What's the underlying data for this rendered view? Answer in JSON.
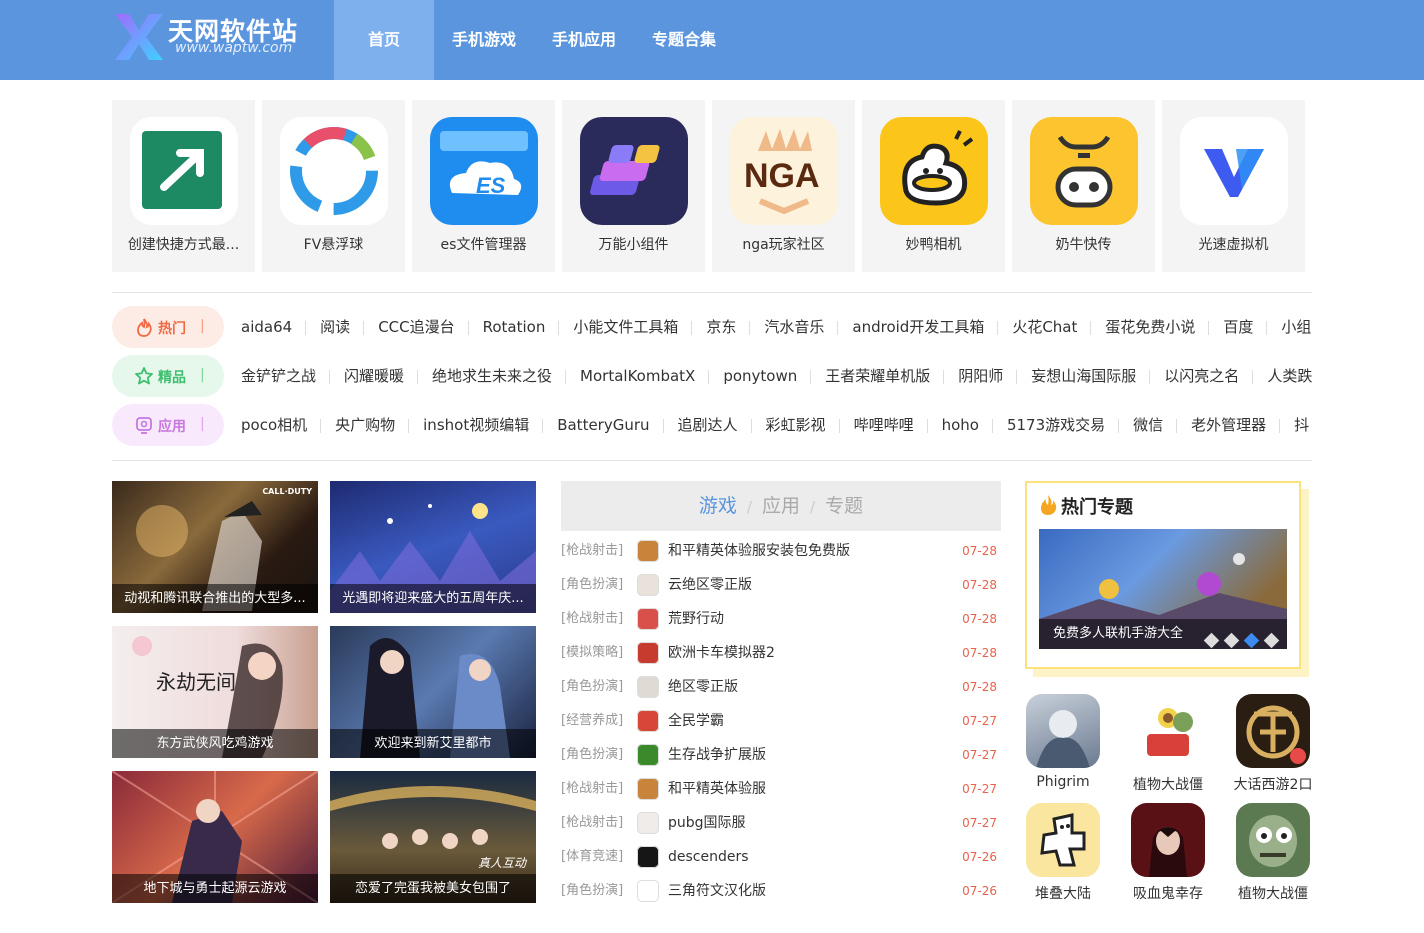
{
  "header": {
    "logo_name": "天网软件站",
    "logo_url": "www.waptw.com",
    "nav": [
      {
        "label": "首页",
        "active": true
      },
      {
        "label": "手机游戏"
      },
      {
        "label": "手机应用"
      },
      {
        "label": "专题合集"
      }
    ],
    "colors": {
      "bar": "#5b95de",
      "active": "#7eb0ee"
    }
  },
  "featured_apps": [
    {
      "name": "创建快捷方式最...",
      "icon": "arrow-shortcut-icon",
      "bg": "#1e8a63"
    },
    {
      "name": "FV悬浮球",
      "icon": "ring-icon",
      "bg": "#ffffff"
    },
    {
      "name": "es文件管理器",
      "icon": "es-folder-cloud-icon",
      "bg": "#1f8df0"
    },
    {
      "name": "万能小组件",
      "icon": "widget-stack-icon",
      "bg": "#2a2b5a"
    },
    {
      "name": "nga玩家社区",
      "icon": "nga-logo-icon",
      "bg": "#fdf2dc"
    },
    {
      "name": "妙鸭相机",
      "icon": "duck-camera-icon",
      "bg": "#fcc51a"
    },
    {
      "name": "奶牛快传",
      "icon": "cow-face-icon",
      "bg": "#fcc52f"
    },
    {
      "name": "光速虚拟机",
      "icon": "v-logo-icon",
      "bg": "#ffffff"
    }
  ],
  "tag_rows": [
    {
      "label": "热门",
      "sep": "|",
      "icon": "fire-icon",
      "color": "#f06a44",
      "bg": "#fdece6",
      "items": [
        "aida64",
        "阅读",
        "CCC追漫台",
        "Rotation",
        "小能文件工具箱",
        "京东",
        "汽水音乐",
        "android开发工具箱",
        "火花Chat",
        "蛋花免费小说",
        "百度",
        "小组"
      ]
    },
    {
      "label": "精品",
      "sep": "|",
      "icon": "star-icon",
      "color": "#3cbf6e",
      "bg": "#e6f7ec",
      "items": [
        "金铲铲之战",
        "闪耀暖暖",
        "绝地求生未来之役",
        "MortalKombatX",
        "ponytown",
        "王者荣耀单机版",
        "阴阳师",
        "妄想山海国际服",
        "以闪亮之名",
        "人类跌"
      ]
    },
    {
      "label": "应用",
      "sep": "|",
      "icon": "app-icon",
      "color": "#c877e0",
      "bg": "#f8eafc",
      "items": [
        "poco相机",
        "央广购物",
        "inshot视频编辑",
        "BatteryGuru",
        "追剧达人",
        "彩虹影视",
        "哔哩哔哩",
        "hoho",
        "5173游戏交易",
        "微信",
        "老外管理器",
        "抖"
      ]
    }
  ],
  "news": [
    {
      "caption": "动视和腾讯联合推出的大型多...",
      "badge": "CALL·DUTY"
    },
    {
      "caption": "光遇即将迎来盛大的五周年庆..."
    },
    {
      "caption": "东方武侠风吃鸡游戏",
      "badge": "永劫无间"
    },
    {
      "caption": "欢迎来到新艾里都市"
    },
    {
      "caption": "地下城与勇士起源云游戏"
    },
    {
      "caption": "恋爱了完蛋我被美女包围了",
      "badge": "真人互动"
    }
  ],
  "list": {
    "tabs": [
      {
        "label": "游戏",
        "active": true
      },
      {
        "label": "应用"
      },
      {
        "label": "专题"
      }
    ],
    "sep": "/",
    "rows": [
      {
        "cat": "[枪战射击]",
        "name": "和平精英体验服安装包免费版",
        "date": "07-28",
        "color": "#c8843a"
      },
      {
        "cat": "[角色扮演]",
        "name": "云绝区零正版",
        "date": "07-28",
        "color": "#e8e2da"
      },
      {
        "cat": "[枪战射击]",
        "name": "荒野行动",
        "date": "07-28",
        "color": "#d9504a"
      },
      {
        "cat": "[模拟策略]",
        "name": "欧洲卡车模拟器2",
        "date": "07-28",
        "color": "#c73a2e"
      },
      {
        "cat": "[角色扮演]",
        "name": "绝区零正版",
        "date": "07-28",
        "color": "#e0dad4"
      },
      {
        "cat": "[经营养成]",
        "name": "全民学霸",
        "date": "07-27",
        "color": "#d84637"
      },
      {
        "cat": "[角色扮演]",
        "name": "生存战争扩展版",
        "date": "07-27",
        "color": "#3a8a2c"
      },
      {
        "cat": "[枪战射击]",
        "name": "和平精英体验服",
        "date": "07-27",
        "color": "#c8843a"
      },
      {
        "cat": "[枪战射击]",
        "name": "pubg国际服",
        "date": "07-27",
        "color": "#f0ecea"
      },
      {
        "cat": "[体育竞速]",
        "name": "descenders",
        "date": "07-26",
        "color": "#161616"
      },
      {
        "cat": "[角色扮演]",
        "name": "三角符文汉化版",
        "date": "07-26",
        "color": "#ffffff"
      }
    ]
  },
  "topic": {
    "title": "热门专题",
    "caption": "免费多人联机手游大全",
    "dots": 4,
    "active_dot": 3
  },
  "side_apps": [
    {
      "name": "Phigrim",
      "bg": "#8a9aae"
    },
    {
      "name": "植物大战僵",
      "bg": "#ffffff"
    },
    {
      "name": "大话西游2口",
      "bg": "#2a1e12"
    },
    {
      "name": "堆叠大陆",
      "bg": "#fbe6a0"
    },
    {
      "name": "吸血鬼幸存",
      "bg": "#5a1116"
    },
    {
      "name": "植物大战僵",
      "bg": "#5c7a52"
    }
  ]
}
